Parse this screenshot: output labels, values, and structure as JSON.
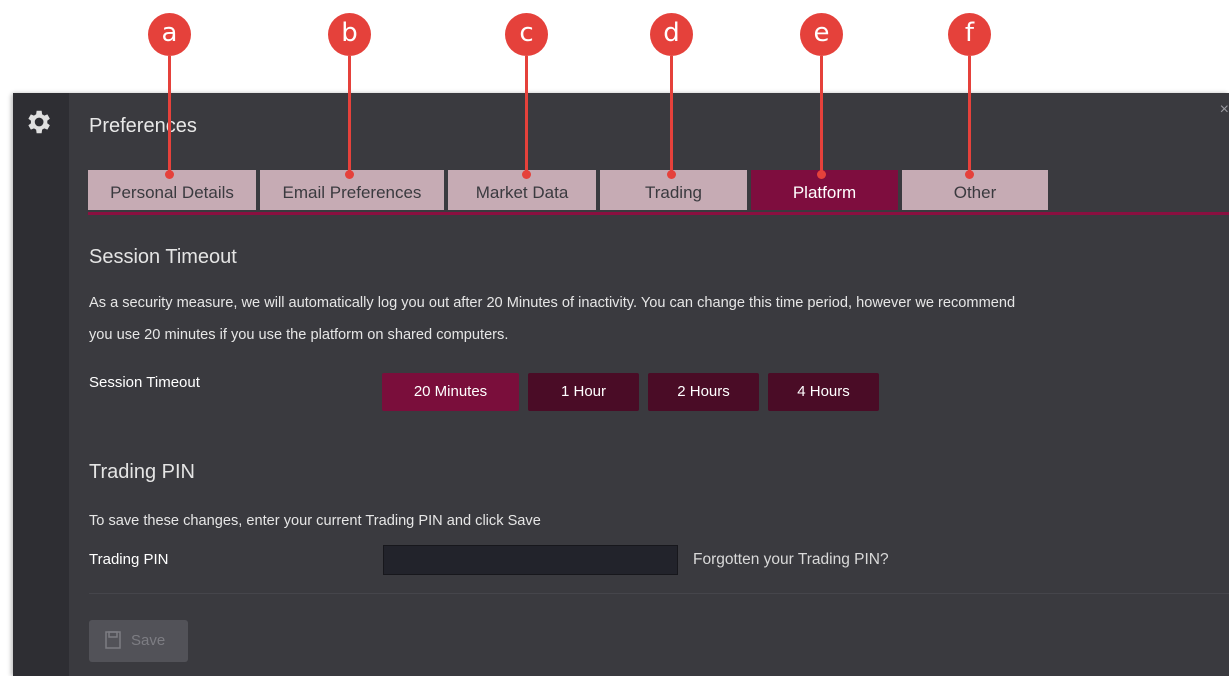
{
  "annotations": [
    "a",
    "b",
    "c",
    "d",
    "e",
    "f"
  ],
  "dialog": {
    "title": "Preferences",
    "close_glyph": "×",
    "icon": "gear-icon"
  },
  "tabs": [
    {
      "label": "Personal Details",
      "active": false
    },
    {
      "label": "Email Preferences",
      "active": false
    },
    {
      "label": "Market Data",
      "active": false
    },
    {
      "label": "Trading",
      "active": false
    },
    {
      "label": "Platform",
      "active": true
    },
    {
      "label": "Other",
      "active": false
    }
  ],
  "session_timeout": {
    "heading": "Session Timeout",
    "description_line1": "As a security measure, we will automatically log you out after 20 Minutes of inactivity. You can change this time period, however we recommend",
    "description_line2": "you use 20 minutes if you use the platform on shared computers.",
    "label": "Session Timeout",
    "options": [
      "20 Minutes",
      "1 Hour",
      "2 Hours",
      "4 Hours"
    ],
    "selected": "20 Minutes"
  },
  "trading_pin": {
    "heading": "Trading PIN",
    "instructions": "To save these changes, enter your current Trading PIN and click Save",
    "label": "Trading PIN",
    "value": "",
    "forgot_link": "Forgotten your Trading PIN?"
  },
  "save": {
    "label": "Save",
    "icon": "save-icon",
    "enabled": false
  },
  "colors": {
    "accent": "#7e0d3e",
    "tab_inactive": "#c6abb4",
    "annotation": "#e5413b",
    "panel_bg": "#3a3a3f"
  }
}
